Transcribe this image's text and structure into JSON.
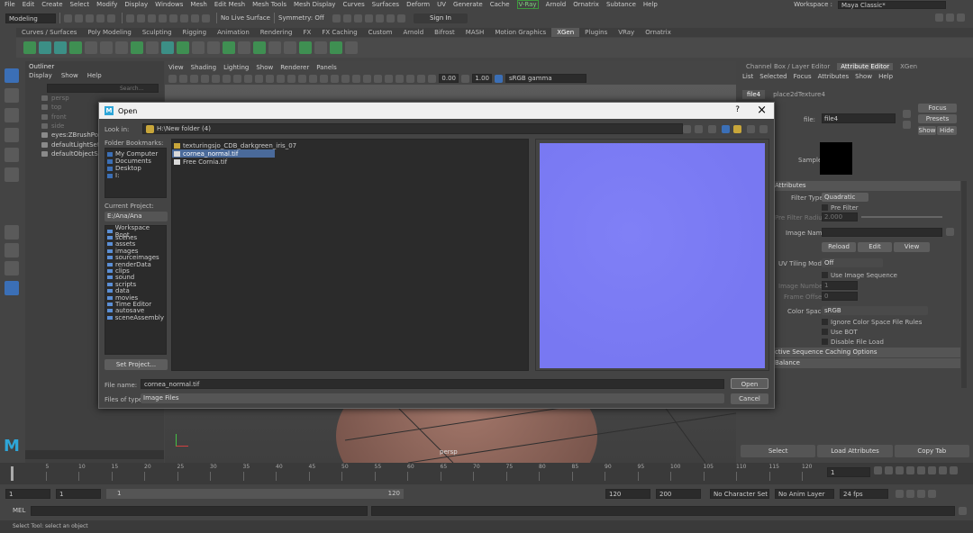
{
  "main_menu": [
    "File",
    "Edit",
    "Create",
    "Select",
    "Modify",
    "Display",
    "Windows",
    "Mesh",
    "Edit Mesh",
    "Mesh Tools",
    "Mesh Display",
    "Curves",
    "Surfaces",
    "Deform",
    "UV",
    "Generate",
    "Cache",
    "V-Ray",
    "Arnold",
    "Ornatrix",
    "Subtance",
    "Help"
  ],
  "workspace": {
    "label": "Workspace :",
    "value": "Maya Classic*"
  },
  "status_line": {
    "mode": "Modeling",
    "live_surface": "No Live Surface",
    "symmetry": "Symmetry: Off",
    "sign_in": "Sign In"
  },
  "shelf_tabs": [
    "Curves / Surfaces",
    "Poly Modeling",
    "Sculpting",
    "Rigging",
    "Animation",
    "Rendering",
    "FX",
    "FX Caching",
    "Custom",
    "Arnold",
    "Bifrost",
    "MASH",
    "Motion Graphics",
    "XGen",
    "Plugins",
    "VRay",
    "Ornatrix"
  ],
  "shelf_active": "XGen",
  "outliner": {
    "title": "Outliner",
    "menu": [
      "Display",
      "Show",
      "Help"
    ],
    "search_placeholder": "Search...",
    "items": [
      "persp",
      "top",
      "front",
      "side",
      "eyes:ZBrushPolyM",
      "defaultLightSet",
      "defaultObjectSet"
    ]
  },
  "viewport": {
    "menu": [
      "View",
      "Shading",
      "Lighting",
      "Show",
      "Renderer",
      "Panels"
    ],
    "num1": "0.00",
    "num2": "1.00",
    "color_space": "sRGB gamma",
    "camera_label": "persp"
  },
  "dialog": {
    "title": "Open",
    "help_glyph": "?",
    "close_glyph": "×",
    "look_in_label": "Look in:",
    "look_in_value": "H:\\New folder (4)",
    "bookmarks_label": "Folder Bookmarks:",
    "bookmarks": [
      "My Computer",
      "Documents",
      "Desktop",
      "I:"
    ],
    "current_project_label": "Current Project:",
    "current_project": "E:/Ana/Ana",
    "project_folders": [
      "Workspace Root",
      "scenes",
      "assets",
      "images",
      "sourceimages",
      "renderData",
      "clips",
      "sound",
      "scripts",
      "data",
      "movies",
      "Time Editor",
      "autosave",
      "sceneAssembly"
    ],
    "set_project": "Set Project...",
    "files": [
      {
        "name": "texturingsjo_CDB_darkgreen_iris_07",
        "type": "folder",
        "selected": false
      },
      {
        "name": "cornea_normal.tif",
        "type": "file",
        "selected": true
      },
      {
        "name": "Free Cornia.tif",
        "type": "file",
        "selected": false
      }
    ],
    "file_name_label": "File name:",
    "file_name_value": "cornea_normal.tif",
    "file_type_label": "Files of type:",
    "file_type_value": "Image Files",
    "open_button": "Open",
    "cancel_button": "Cancel",
    "preview_color": "#7878f2"
  },
  "attr_editor": {
    "header_tabs": [
      "Channel Box / Layer Editor",
      "Attribute Editor",
      "XGen"
    ],
    "active_header": "Attribute Editor",
    "menu": [
      "List",
      "Selected",
      "Focus",
      "Attributes",
      "Show",
      "Help"
    ],
    "node_tabs": [
      "file4",
      "place2dTexture4"
    ],
    "file_label": "file:",
    "file_value": "file4",
    "focus": "Focus",
    "presets": "Presets",
    "show": "Show",
    "hide": "Hide",
    "sample_label": "Sample",
    "section_file_attributes": "Attributes",
    "filter_type_label": "Filter Type",
    "filter_type_value": "Quadratic",
    "pre_filter": "Pre Filter",
    "pre_filter_radius_label": "Pre Filter Radius",
    "pre_filter_radius_value": "2.000",
    "image_name_label": "Image Name",
    "reload": "Reload",
    "edit": "Edit",
    "view": "View",
    "uv_tiling_label": "UV Tiling Mode",
    "uv_tiling_value": "Off",
    "use_image_sequence": "Use Image Sequence",
    "image_number_label": "Image Number",
    "image_number_value": "1",
    "frame_offset_label": "Frame Offset",
    "frame_offset_value": "0",
    "color_space_label": "Color Space",
    "color_space_value": "sRGB",
    "ignore_cs_rules": "Ignore Color Space File Rules",
    "use_bot": "Use BOT",
    "disable_file_load": "Disable File Load",
    "section_caching": "ctive Sequence Caching Options",
    "section_balance": "Balance",
    "bottom_buttons": [
      "Select",
      "Load Attributes",
      "Copy Tab"
    ]
  },
  "timeline": {
    "ticks": [
      "5",
      "10",
      "15",
      "20",
      "25",
      "30",
      "35",
      "40",
      "45",
      "50",
      "55",
      "60",
      "65",
      "70",
      "75",
      "80",
      "85",
      "90",
      "95",
      "100",
      "105",
      "110",
      "115",
      "120"
    ],
    "current_frame": "1"
  },
  "range": {
    "start": "1",
    "start2": "1",
    "slider_start": "1",
    "slider_end": "120",
    "end": "120",
    "end2": "200",
    "character_set": "No Character Set",
    "anim_layer": "No Anim Layer",
    "fps": "24 fps"
  },
  "command_line": {
    "label": "MEL"
  },
  "help_line": "Select Tool: select an object"
}
